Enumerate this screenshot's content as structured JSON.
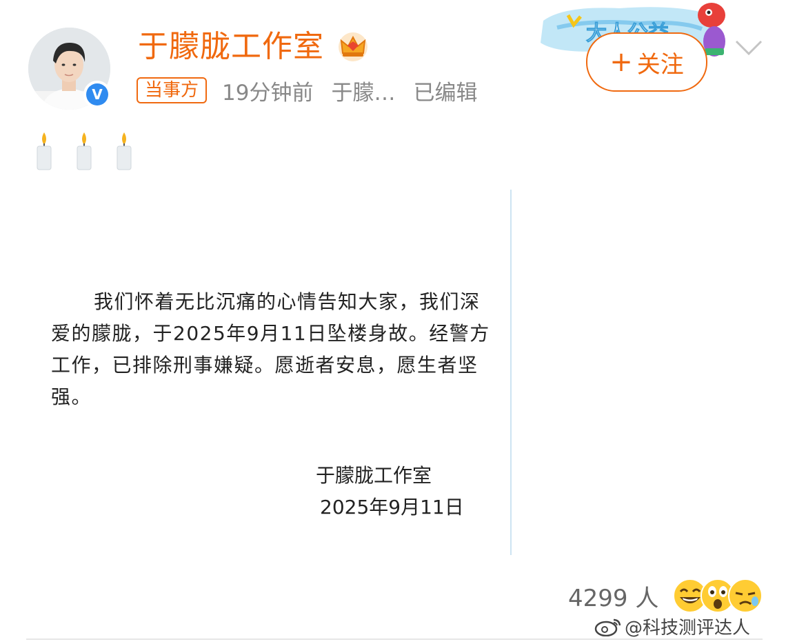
{
  "post": {
    "author_name": "于朦胧工作室",
    "badge_label": "当事方",
    "time": "19分钟前",
    "source": "于朦…",
    "edited": "已编辑",
    "follow_plus": "+",
    "follow_label": "关注",
    "banner_text": "大人公益"
  },
  "statement": {
    "body": "我们怀着无比沉痛的心情告知大家，我们深爱的朦胧，于2025年9月11日坠楼身故。经警方工作，已排除刑事嫌疑。愿逝者安息，愿生者坚强。",
    "signature": "于朦胧工作室",
    "date": "2025年9月11日"
  },
  "footer": {
    "reaction_count": "4299 人",
    "watermark": "@科技测评达人"
  },
  "icons": {
    "avatar": "user-avatar-photo",
    "verified": "verified-v-icon",
    "crown": "crown-icon",
    "chevron": "chevron-down-icon",
    "candle": "candle-emoji",
    "reaction_emojis": [
      "laughing-emoji",
      "surprised-emoji",
      "crying-emoji"
    ],
    "weibo_logo": "weibo-logo-icon"
  },
  "colors": {
    "accent": "#f0690f",
    "verified_blue": "#2f8bf0",
    "meta_gray": "#888888"
  }
}
